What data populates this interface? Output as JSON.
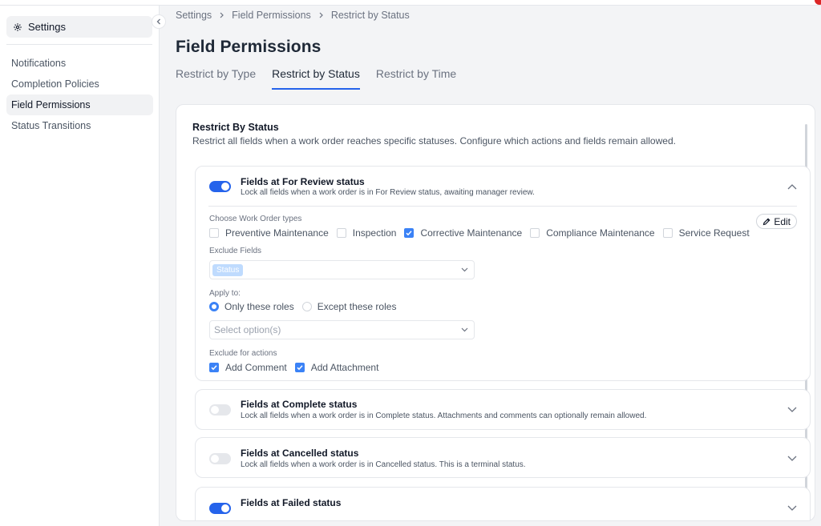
{
  "sidebar": {
    "header_label": "Settings",
    "items": [
      {
        "label": "Notifications",
        "active": false
      },
      {
        "label": "Completion Policies",
        "active": false
      },
      {
        "label": "Field Permissions",
        "active": true
      },
      {
        "label": "Status Transitions",
        "active": false
      }
    ]
  },
  "breadcrumb": [
    "Settings",
    "Field Permissions",
    "Restrict by Status"
  ],
  "page_title": "Field Permissions",
  "tabs": [
    {
      "label": "Restrict by Type",
      "active": false
    },
    {
      "label": "Restrict by Status",
      "active": true
    },
    {
      "label": "Restrict by Time",
      "active": false
    }
  ],
  "section": {
    "title": "Restrict By Status",
    "description": "Restrict all fields when a work order reaches specific statuses. Configure which actions and fields remain allowed."
  },
  "panels": [
    {
      "title": "Fields at For Review status",
      "description": "Lock all fields when a work order is in For Review status, awaiting manager review.",
      "enabled": true,
      "expanded": true,
      "body": {
        "work_order_types_label": "Choose Work Order types",
        "edit_label": "Edit",
        "work_order_types": [
          {
            "label": "Preventive Maintenance",
            "checked": false
          },
          {
            "label": "Inspection",
            "checked": false
          },
          {
            "label": "Corrective Maintenance",
            "checked": true
          },
          {
            "label": "Compliance Maintenance",
            "checked": false
          },
          {
            "label": "Service Request",
            "checked": false
          }
        ],
        "exclude_fields_label": "Exclude Fields",
        "exclude_fields_tag": "Status",
        "apply_to_label": "Apply to:",
        "apply_to_options": [
          {
            "label": "Only these roles",
            "checked": true
          },
          {
            "label": "Except these roles",
            "checked": false
          }
        ],
        "roles_placeholder": "Select option(s)",
        "exclude_actions_label": "Exclude for actions",
        "actions": [
          {
            "label": "Add Comment",
            "checked": true
          },
          {
            "label": "Add Attachment",
            "checked": true
          }
        ]
      }
    },
    {
      "title": "Fields at Complete status",
      "description": "Lock all fields when a work order is in Complete status. Attachments and comments can optionally remain allowed.",
      "enabled": false,
      "expanded": false
    },
    {
      "title": "Fields at Cancelled status",
      "description": "Lock all fields when a work order is in Cancelled status. This is a terminal status.",
      "enabled": false,
      "expanded": false
    },
    {
      "title": "Fields at Failed status",
      "description": "",
      "enabled": true,
      "expanded": false
    }
  ],
  "colors": {
    "accent": "#2563eb",
    "checkbox": "#3b82f6",
    "badge": "#dc2626"
  }
}
